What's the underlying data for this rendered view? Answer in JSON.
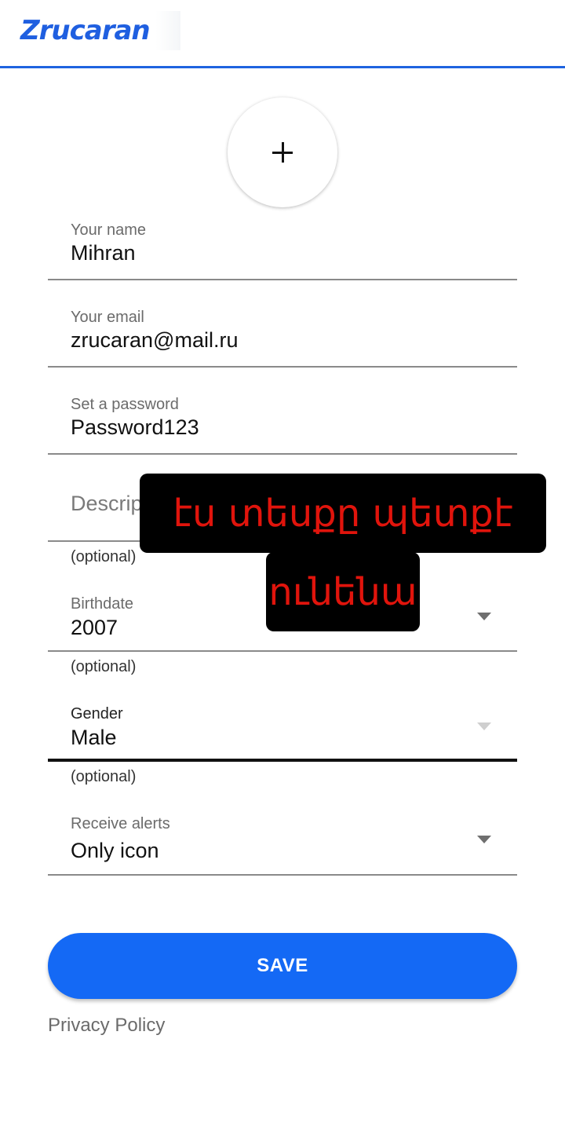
{
  "header": {
    "logo_text": "Zrucaran"
  },
  "avatar": {
    "icon": "plus-icon"
  },
  "form": {
    "name": {
      "label": "Your name",
      "value": "Mihran"
    },
    "email": {
      "label": "Your email",
      "value": "zrucaran@mail.ru"
    },
    "password": {
      "label": "Set a password",
      "value": "Password123"
    },
    "description": {
      "placeholder": "Description",
      "helper": "(optional)"
    },
    "birthdate": {
      "label": "Birthdate",
      "value": "2007",
      "helper": "(optional)"
    },
    "gender": {
      "label": "Gender",
      "value": "Male",
      "helper": "(optional)"
    },
    "alerts": {
      "label": "Receive alerts",
      "value": "Only icon"
    }
  },
  "overlay": {
    "line1": "էս տեսքը պետքէ",
    "line2": "ունենա"
  },
  "actions": {
    "save_label": "SAVE",
    "privacy_label": "Privacy Policy"
  },
  "colors": {
    "accent": "#1469f5",
    "overlay_text": "#e0140c"
  }
}
